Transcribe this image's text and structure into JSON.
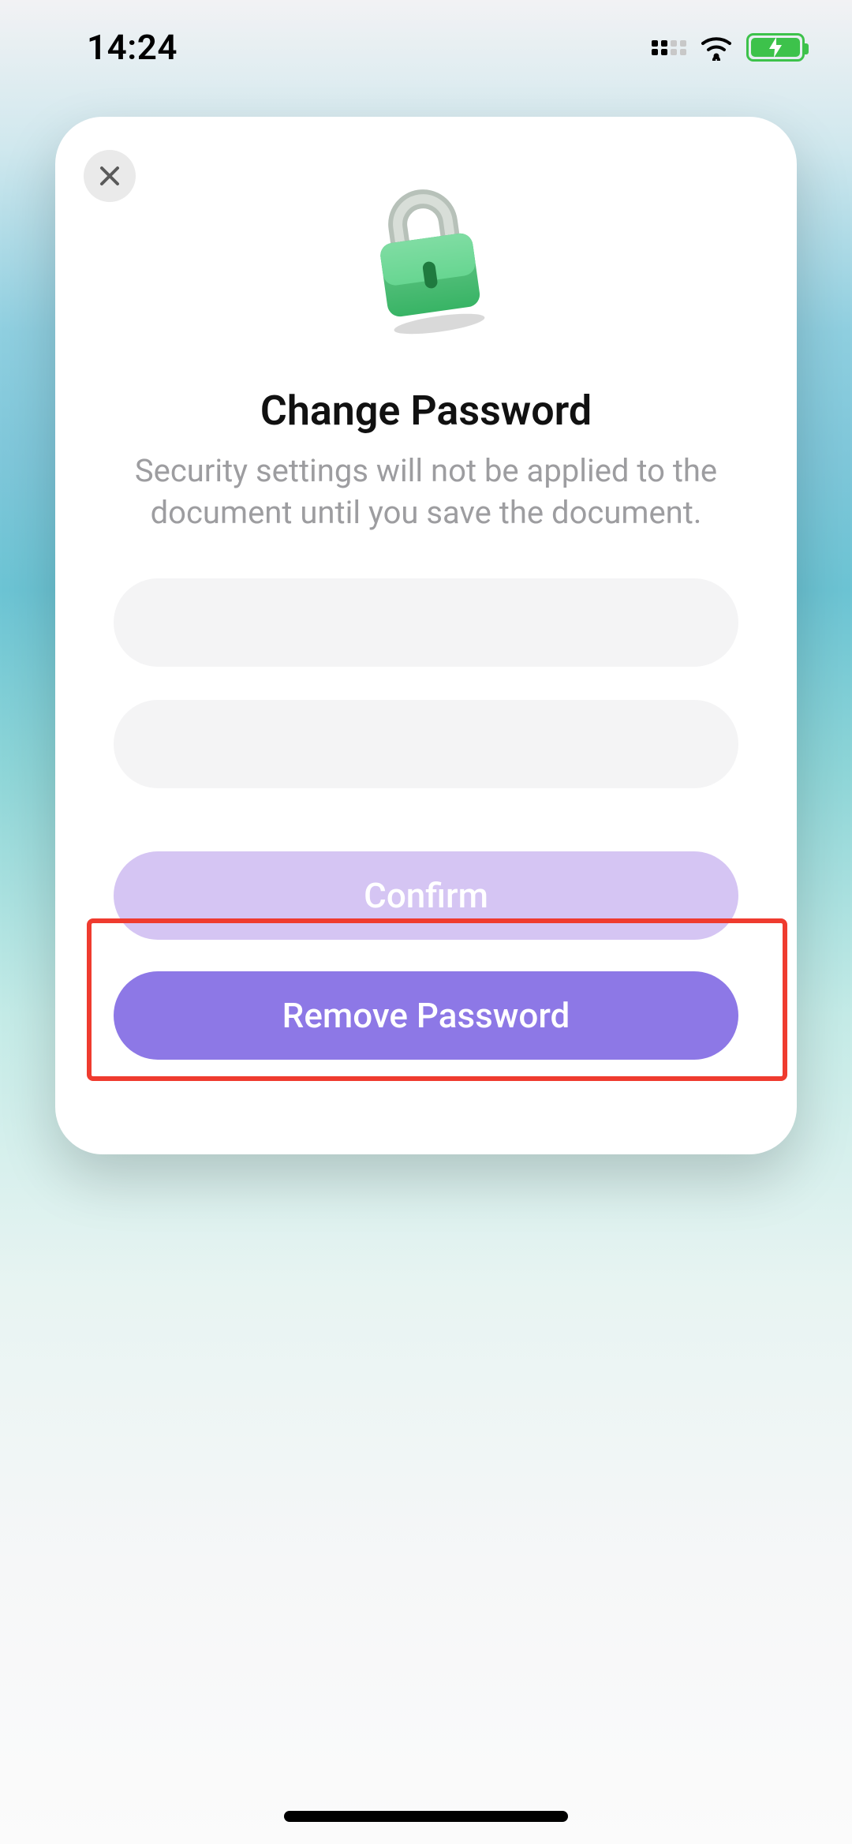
{
  "status": {
    "time": "14:24"
  },
  "modal": {
    "title": "Change Password",
    "subtitle": "Security settings will not be applied to the document until you save the document.",
    "password_value": "",
    "confirm_value": "",
    "confirm_label": "Confirm",
    "remove_label": "Remove Password"
  },
  "icons": {
    "close": "close-icon",
    "lock": "lock-icon",
    "wifi": "wifi-icon",
    "battery_charging": "battery-charging-icon",
    "signal": "signal-icon"
  },
  "colors": {
    "confirm_button": "#d5c5f3",
    "remove_button": "#8d78e6",
    "highlight_border": "#ef3b2f",
    "lock_body": "#4fcf7a"
  }
}
